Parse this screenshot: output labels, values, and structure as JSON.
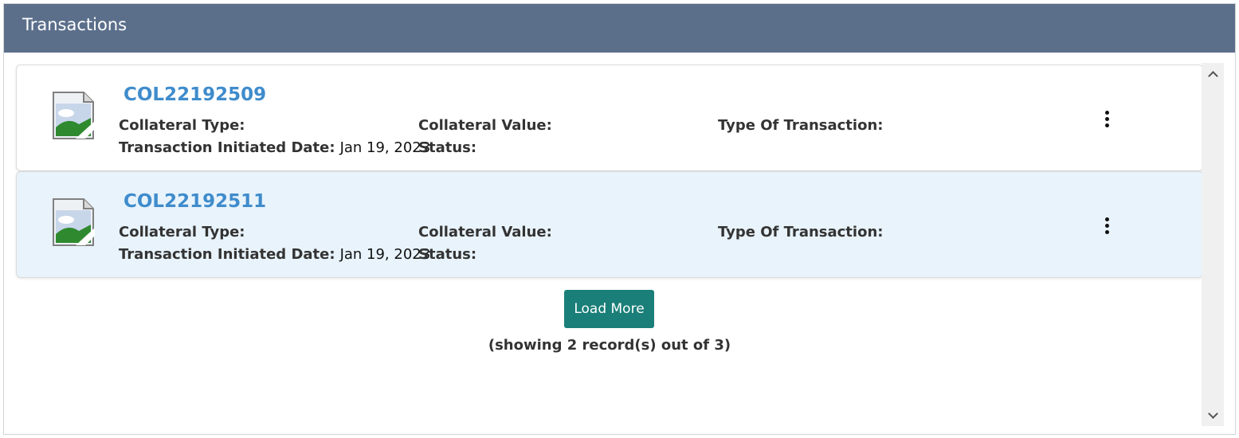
{
  "panel": {
    "title": "Transactions"
  },
  "labels": {
    "collateral_type": "Collateral Type:",
    "collateral_value": "Collateral Value:",
    "type_of_transaction": "Type Of Transaction:",
    "initiated_date": "Transaction Initiated Date:",
    "status": "Status:"
  },
  "transactions": [
    {
      "id": "COL22192509",
      "collateral_type": "",
      "collateral_value": "",
      "type_of_transaction": "",
      "initiated_date": "Jan 19, 2023",
      "status": "",
      "selected": false
    },
    {
      "id": "COL22192511",
      "collateral_type": "",
      "collateral_value": "",
      "type_of_transaction": "",
      "initiated_date": "Jan 19, 2023",
      "status": "",
      "selected": true
    }
  ],
  "load_more_label": "Load More",
  "records_text": "(showing 2 record(s) out of 3)",
  "icons": {
    "thumbnail": "broken-image-icon",
    "menu": "kebab-menu-icon"
  },
  "colors": {
    "header_bg": "#5b6f8b",
    "link": "#3f8ccc",
    "button_bg": "#1a7f78",
    "selected_row_bg": "#e8f3fb"
  }
}
